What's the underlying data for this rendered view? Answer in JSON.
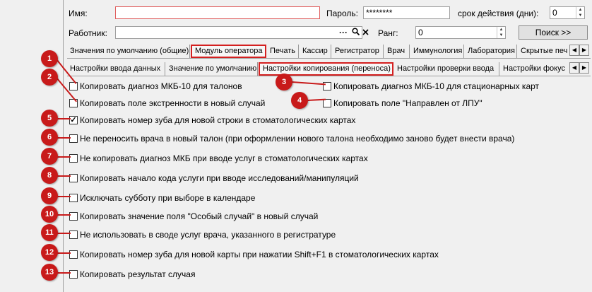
{
  "form": {
    "name_label": "Имя:",
    "name_value": "",
    "password_label": "Пароль:",
    "password_value": "********",
    "validity_label": "срок действия (дни):",
    "validity_value": "0",
    "worker_label": "Работник:",
    "worker_value": "",
    "worker_ellipsis": "···",
    "rank_label": "Ранг:",
    "rank_value": "0",
    "search_button": "Поиск  >>"
  },
  "tabs_top": [
    {
      "label": "Значения по умолчанию (общие)"
    },
    {
      "label": "Модуль оператора"
    },
    {
      "label": "Печать"
    },
    {
      "label": "Кассир"
    },
    {
      "label": "Регистратор"
    },
    {
      "label": "Врач"
    },
    {
      "label": "Иммунология"
    },
    {
      "label": "Лаборатория"
    },
    {
      "label": "Скрытые печ"
    }
  ],
  "tabs_sub": [
    {
      "label": "Настройки ввода данных"
    },
    {
      "label": "Значение по умолчанию"
    },
    {
      "label": "Настройки копирования (переноса)"
    },
    {
      "label": "Настройки проверки ввода"
    },
    {
      "label": "Настройки фокус"
    }
  ],
  "checkboxes": [
    {
      "label": "Копировать диагноз МКБ-10 для талонов",
      "checked": false
    },
    {
      "label": "Копировать диагноз МКБ-10 для стационарных карт",
      "checked": false
    },
    {
      "label": "Копировать поле экстренности в новый случай",
      "checked": false
    },
    {
      "label": "Копировать поле \"Направлен от ЛПУ\"",
      "checked": false
    },
    {
      "label": "Копировать номер зуба для новой строки в стоматологических картах",
      "checked": true
    },
    {
      "label": "Не переносить врача в новый талон (при оформлении нового талона необходимо заново будет внести врача)",
      "checked": false
    },
    {
      "label": "Не копировать диагноз МКБ при вводе услуг в стоматологических картах",
      "checked": false
    },
    {
      "label": "Копировать начало кода услуги при вводе исследований/манипуляций",
      "checked": false
    },
    {
      "label": "Исключать субботу при выборе в календаре",
      "checked": false
    },
    {
      "label": "Копировать значение поля \"Особый случай\" в новый случай",
      "checked": false
    },
    {
      "label": "Не использовать в своде услуг врача, указанного в регистратуре",
      "checked": false
    },
    {
      "label": "Копировать номер зуба для новой карты при нажатии Shift+F1 в стоматологических картах",
      "checked": false
    },
    {
      "label": "Копировать результат случая",
      "checked": false
    }
  ],
  "markers": [
    "1",
    "2",
    "3",
    "4",
    "5",
    "6",
    "7",
    "8",
    "9",
    "10",
    "11",
    "12",
    "13"
  ],
  "colors": {
    "accent_red": "#c81a1a",
    "tab_highlight": "#d42020"
  }
}
